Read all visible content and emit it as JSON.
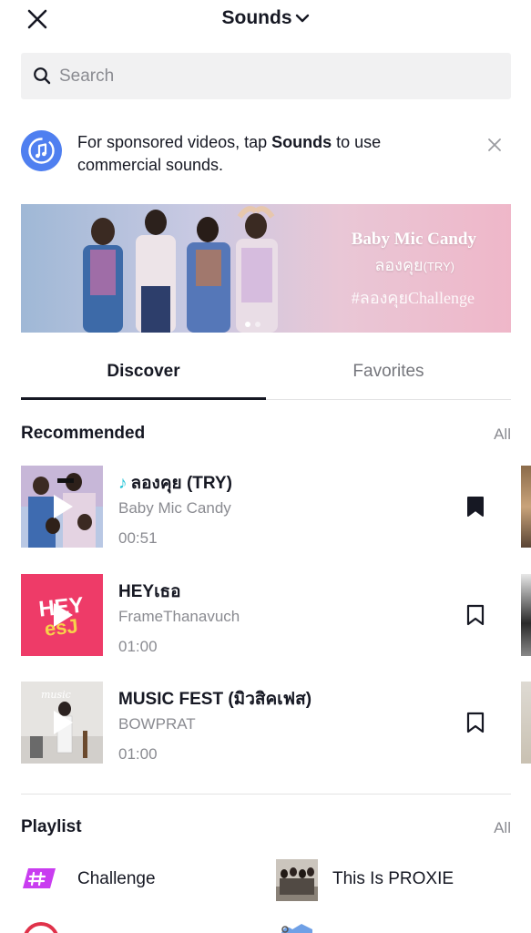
{
  "header": {
    "title": "Sounds"
  },
  "search": {
    "placeholder": "Search"
  },
  "notice": {
    "text_before": "For sponsored videos, tap ",
    "text_bold": "Sounds",
    "text_after": " to use commercial sounds."
  },
  "banner": {
    "artist": "Baby Mic Candy",
    "song": "ลองคุย",
    "song_suffix": "(TRY)",
    "hashtag": "#ลองคุยChallenge"
  },
  "tabs": [
    {
      "label": "Discover",
      "active": true
    },
    {
      "label": "Favorites",
      "active": false
    }
  ],
  "recommended": {
    "heading": "Recommended",
    "all_label": "All",
    "songs": [
      {
        "title": "ลองคุย (TRY)",
        "artist": "Baby Mic Candy",
        "duration": "00:51",
        "bookmarked": true,
        "has_note": true
      },
      {
        "title": "HEYเธอ",
        "artist": "FrameThanavuch",
        "duration": "01:00",
        "bookmarked": false,
        "has_note": false
      },
      {
        "title": "MUSIC FEST (มิวสิคเฟส)",
        "artist": "BOWPRAT",
        "duration": "01:00",
        "bookmarked": false,
        "has_note": false
      }
    ]
  },
  "playlist": {
    "heading": "Playlist",
    "all_label": "All",
    "items": [
      {
        "label": "Challenge"
      },
      {
        "label": "This Is PROXIE"
      }
    ]
  },
  "colors": {
    "accent_note": "#25c4d6",
    "notice_icon": "#4f7ff0",
    "challenge_tag": "#c93df0",
    "text_primary": "#161823",
    "text_secondary": "#8a8b91"
  }
}
